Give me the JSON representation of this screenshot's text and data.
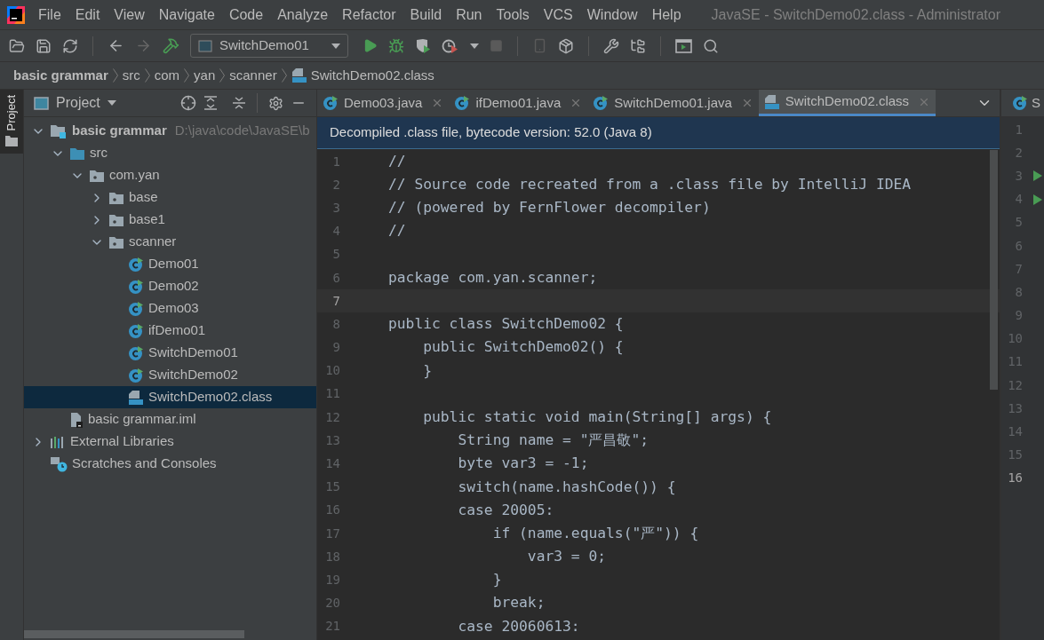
{
  "menu": [
    "File",
    "Edit",
    "View",
    "Navigate",
    "Code",
    "Analyze",
    "Refactor",
    "Build",
    "Run",
    "Tools",
    "VCS",
    "Window",
    "Help"
  ],
  "window": {
    "title": "JavaSE - SwitchDemo02.class - Administrator"
  },
  "toolbar": {
    "run_config": "SwitchDemo01"
  },
  "breadcrumbs": [
    {
      "label": "basic grammar",
      "kind": "project"
    },
    {
      "label": "src",
      "kind": "folder"
    },
    {
      "label": "com",
      "kind": "folder"
    },
    {
      "label": "yan",
      "kind": "folder"
    },
    {
      "label": "scanner",
      "kind": "folder"
    },
    {
      "label": "SwitchDemo02.class",
      "kind": "classfile"
    }
  ],
  "side_strip": {
    "label": "Project"
  },
  "project_panel": {
    "title": "Project",
    "tree": [
      {
        "label": "basic grammar",
        "path": "D:\\java\\code\\JavaSE\\b",
        "kind": "module",
        "expanded": true,
        "selected": false,
        "children": [
          {
            "label": "src",
            "kind": "source",
            "expanded": true,
            "selected": false,
            "children": [
              {
                "label": "com.yan",
                "kind": "package",
                "expanded": true,
                "selected": false,
                "children": [
                  {
                    "label": "base",
                    "kind": "package",
                    "expanded": false,
                    "selected": false
                  },
                  {
                    "label": "base1",
                    "kind": "package",
                    "expanded": false,
                    "selected": false
                  },
                  {
                    "label": "scanner",
                    "kind": "package",
                    "expanded": true,
                    "selected": false,
                    "children": [
                      {
                        "label": "Demo01",
                        "kind": "class",
                        "selected": false
                      },
                      {
                        "label": "Demo02",
                        "kind": "class",
                        "selected": false
                      },
                      {
                        "label": "Demo03",
                        "kind": "class",
                        "selected": false
                      },
                      {
                        "label": "ifDemo01",
                        "kind": "class",
                        "selected": false
                      },
                      {
                        "label": "SwitchDemo01",
                        "kind": "class",
                        "selected": false
                      },
                      {
                        "label": "SwitchDemo02",
                        "kind": "class",
                        "selected": false
                      },
                      {
                        "label": "SwitchDemo02.class",
                        "kind": "classfile",
                        "selected": true
                      }
                    ]
                  }
                ]
              }
            ]
          },
          {
            "label": "basic grammar.iml",
            "kind": "iml",
            "selected": false
          }
        ]
      },
      {
        "label": "External Libraries",
        "kind": "libraries",
        "expanded": false,
        "selected": false
      },
      {
        "label": "Scratches and Consoles",
        "kind": "scratches",
        "selected": false
      }
    ]
  },
  "editor": {
    "tabs": [
      {
        "label": "Demo03.java",
        "kind": "class",
        "selected": false
      },
      {
        "label": "ifDemo01.java",
        "kind": "class",
        "selected": false
      },
      {
        "label": "SwitchDemo01.java",
        "kind": "class",
        "selected": false
      },
      {
        "label": "SwitchDemo02.class",
        "kind": "classfile",
        "selected": true
      }
    ],
    "banner": "Decompiled .class file, bytecode version: 52.0 (Java 8)",
    "lines": [
      {
        "number": "1",
        "text": "//",
        "current": false
      },
      {
        "number": "2",
        "text": "// Source code recreated from a .class file by IntelliJ IDEA",
        "current": false
      },
      {
        "number": "3",
        "text": "// (powered by FernFlower decompiler)",
        "current": false
      },
      {
        "number": "4",
        "text": "//",
        "current": false
      },
      {
        "number": "5",
        "current": false
      },
      {
        "number": "6",
        "text": "package com.yan.scanner;",
        "current": false
      },
      {
        "number": "7",
        "current": true
      },
      {
        "number": "8",
        "text": "public class SwitchDemo02 {",
        "current": false
      },
      {
        "number": "9",
        "text": "    public SwitchDemo02() {",
        "current": false
      },
      {
        "number": "10",
        "text": "    }",
        "current": false
      },
      {
        "number": "11",
        "current": false
      },
      {
        "number": "12",
        "text": "    public static void main(String[] args) {",
        "current": false
      },
      {
        "number": "13",
        "text": "        String name = \"严昌敬\";",
        "current": false
      },
      {
        "number": "14",
        "text": "        byte var3 = -1;",
        "current": false
      },
      {
        "number": "15",
        "text": "        switch(name.hashCode()) {",
        "current": false
      },
      {
        "number": "16",
        "text": "        case 20005:",
        "current": false
      },
      {
        "number": "17",
        "text": "            if (name.equals(\"严\")) {",
        "current": false
      },
      {
        "number": "18",
        "text": "                var3 = 0;",
        "current": false
      },
      {
        "number": "19",
        "text": "            }",
        "current": false
      },
      {
        "number": "20",
        "text": "            break;",
        "current": false
      },
      {
        "number": "21",
        "text": "        case 20060613:",
        "current": false
      }
    ]
  },
  "second_editor": {
    "tab": "S",
    "lines": [
      {
        "number": "1",
        "runnable": false,
        "current": false
      },
      {
        "number": "2",
        "runnable": false,
        "current": false
      },
      {
        "number": "3",
        "runnable": true,
        "current": false
      },
      {
        "number": "4",
        "runnable": true,
        "current": false
      },
      {
        "number": "5",
        "runnable": false,
        "current": false
      },
      {
        "number": "6",
        "runnable": false,
        "current": false
      },
      {
        "number": "7",
        "runnable": false,
        "current": false
      },
      {
        "number": "8",
        "runnable": false,
        "current": false
      },
      {
        "number": "9",
        "runnable": false,
        "current": false
      },
      {
        "number": "10",
        "runnable": false,
        "current": false
      },
      {
        "number": "11",
        "runnable": false,
        "current": false
      },
      {
        "number": "12",
        "runnable": false,
        "current": false
      },
      {
        "number": "13",
        "runnable": false,
        "current": false
      },
      {
        "number": "14",
        "runnable": false,
        "current": false
      },
      {
        "number": "15",
        "runnable": false,
        "current": false
      },
      {
        "number": "16",
        "runnable": false,
        "current": true
      }
    ]
  }
}
